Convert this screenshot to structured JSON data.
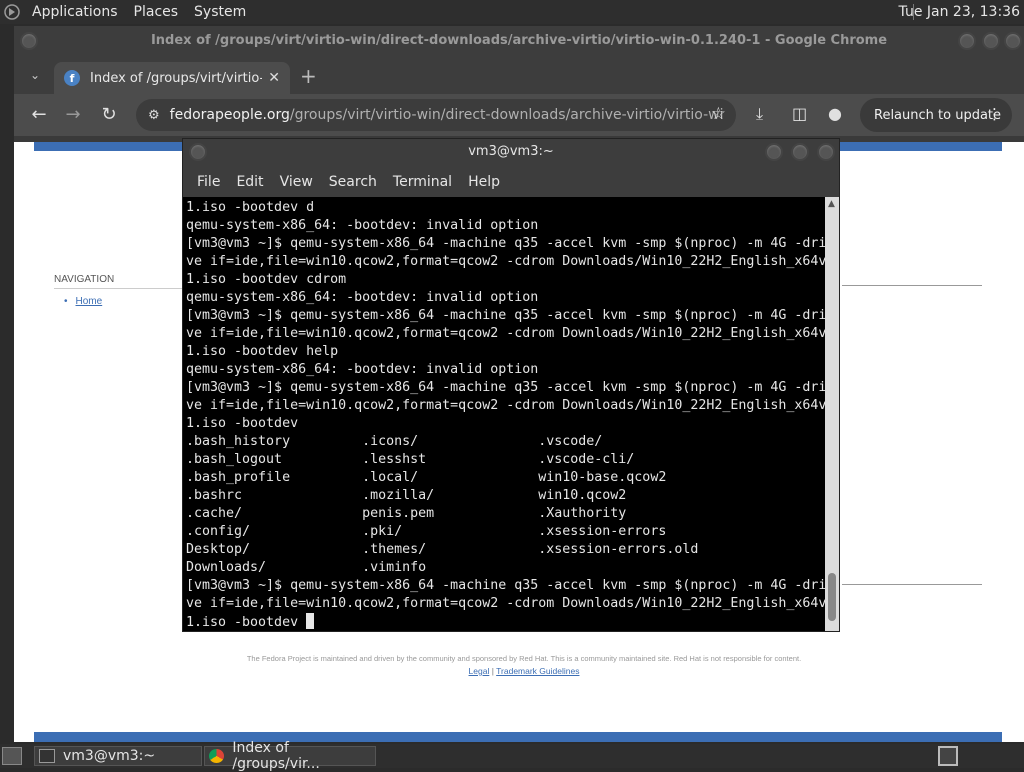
{
  "top_panel": {
    "menus": [
      "Applications",
      "Places",
      "System"
    ],
    "clock": "Tue Jan 23, 13:36"
  },
  "chrome": {
    "window_title": "Index of /groups/virt/virtio-win/direct-downloads/archive-virtio/virtio-win-0.1.240-1 - Google Chrome",
    "tab_title": "Index of /groups/virt/virtio-wi",
    "tab_favicon_letter": "f",
    "url_domain": "fedorapeople.org",
    "url_path": "/groups/virt/virtio-win/direct-downloads/archive-virtio/virtio-win...",
    "relaunch_label": "Relaunch to update",
    "icons": {
      "back": "back-arrow-icon",
      "forward": "forward-arrow-icon",
      "reload": "reload-icon",
      "site_info": "tune-icon",
      "bookmark": "star-icon",
      "download": "download-icon",
      "sidepanel": "side-panel-icon",
      "profile": "profile-icon",
      "menu": "kebab-menu-icon"
    }
  },
  "page": {
    "nav_title": "NAVIGATION",
    "nav_home": "Home",
    "footer_text": "The Fedora Project is maintained and driven by the community and sponsored by Red Hat. This is a community maintained site. Red Hat is not responsible for content.",
    "footer_legal": "Legal",
    "footer_sep": "|",
    "footer_trademark": "Trademark Guidelines"
  },
  "terminal": {
    "title": "vm3@vm3:~",
    "menus": [
      "File",
      "Edit",
      "View",
      "Search",
      "Terminal",
      "Help"
    ],
    "lines": [
      "1.iso -bootdev d",
      "qemu-system-x86_64: -bootdev: invalid option",
      "[vm3@vm3 ~]$ qemu-system-x86_64 -machine q35 -accel kvm -smp $(nproc) -m 4G -dri",
      "ve if=ide,file=win10.qcow2,format=qcow2 -cdrom Downloads/Win10_22H2_English_x64v",
      "1.iso -bootdev cdrom",
      "qemu-system-x86_64: -bootdev: invalid option",
      "[vm3@vm3 ~]$ qemu-system-x86_64 -machine q35 -accel kvm -smp $(nproc) -m 4G -dri",
      "ve if=ide,file=win10.qcow2,format=qcow2 -cdrom Downloads/Win10_22H2_English_x64v",
      "1.iso -bootdev help",
      "qemu-system-x86_64: -bootdev: invalid option",
      "[vm3@vm3 ~]$ qemu-system-x86_64 -machine q35 -accel kvm -smp $(nproc) -m 4G -dri",
      "ve if=ide,file=win10.qcow2,format=qcow2 -cdrom Downloads/Win10_22H2_English_x64v",
      "1.iso -bootdev",
      ".bash_history         .icons/               .vscode/",
      ".bash_logout          .lesshst              .vscode-cli/",
      ".bash_profile         .local/               win10-base.qcow2",
      ".bashrc               .mozilla/             win10.qcow2",
      ".cache/               penis.pem             .Xauthority",
      ".config/              .pki/                 .xsession-errors",
      "Desktop/              .themes/              .xsession-errors.old",
      "Downloads/            .viminfo",
      "[vm3@vm3 ~]$ qemu-system-x86_64 -machine q35 -accel kvm -smp $(nproc) -m 4G -dri",
      "ve if=ide,file=win10.qcow2,format=qcow2 -cdrom Downloads/Win10_22H2_English_x64v"
    ],
    "prompt_line": "1.iso -bootdev "
  },
  "bottom_panel": {
    "tasks": [
      "vm3@vm3:~",
      "Index of /groups/vir..."
    ]
  }
}
